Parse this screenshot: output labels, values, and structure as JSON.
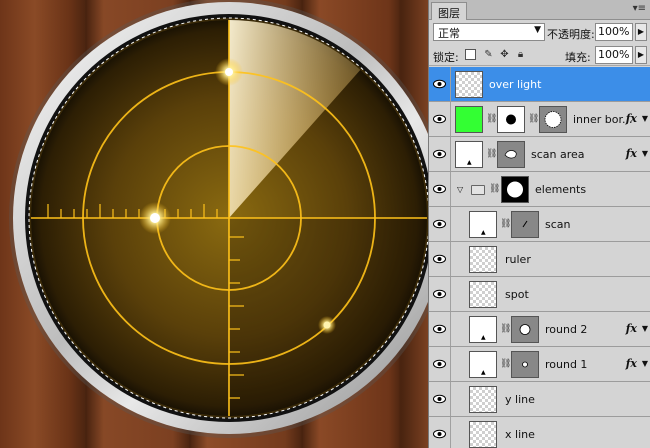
{
  "panel": {
    "tab_title": "图层",
    "blend_mode": "正常",
    "opacity_label": "不透明度:",
    "opacity_value": "100%",
    "lock_label": "锁定:",
    "fill_label": "填充:",
    "fill_value": "100%"
  },
  "layers": [
    {
      "name": "over light",
      "selected": true,
      "fx": false
    },
    {
      "name": "inner bor...",
      "selected": false,
      "fx": true
    },
    {
      "name": "scan area",
      "selected": false,
      "fx": true
    },
    {
      "name": "elements",
      "selected": false,
      "fx": false,
      "group": true
    },
    {
      "name": "scan",
      "selected": false,
      "fx": false
    },
    {
      "name": "ruler",
      "selected": false,
      "fx": false
    },
    {
      "name": "spot",
      "selected": false,
      "fx": false
    },
    {
      "name": "round 2",
      "selected": false,
      "fx": true
    },
    {
      "name": "round 1",
      "selected": false,
      "fx": true
    },
    {
      "name": "y line",
      "selected": false,
      "fx": false
    },
    {
      "name": "x line",
      "selected": false,
      "fx": false
    }
  ],
  "fx_symbol": "fx",
  "colors": {
    "selection": "#3c8ee8",
    "radar_line": "#ffc21a",
    "wood": "#7a4022"
  },
  "icons": [
    "eye-icon",
    "chain-icon",
    "folder-icon",
    "lock-icon",
    "move-icon",
    "brush-icon",
    "checker-icon"
  ]
}
